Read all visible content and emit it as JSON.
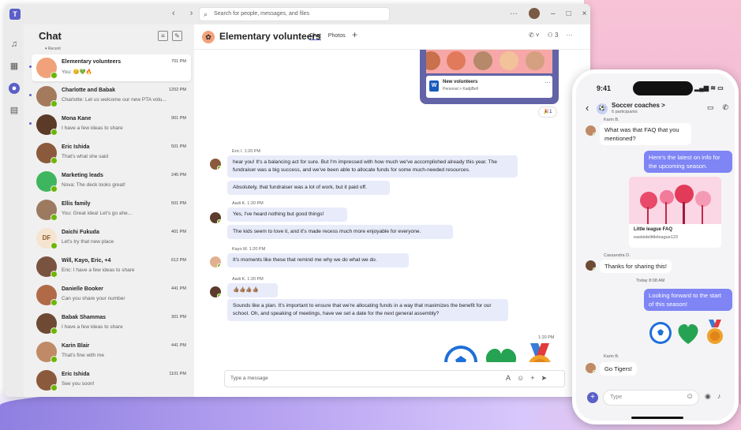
{
  "app": {
    "search_placeholder": "Search for people, messages, and files",
    "nav_arrows": "‹ ›",
    "window_controls": [
      "···",
      "–",
      "□",
      "×"
    ]
  },
  "rail": {
    "icons": [
      "bell-icon",
      "calendar-icon",
      "chat-icon",
      "files-icon"
    ]
  },
  "left": {
    "title": "Chat",
    "recent_label": "▾ Recent",
    "items": [
      {
        "name": "Elementary volunteers",
        "preview": "You: 😊💚🔥",
        "time": "701 PM",
        "avatar_color": "#f2a27a",
        "unread": true
      },
      {
        "name": "Charlotte and Babak",
        "preview": "Charlotte: Let us welcome our new PTA volu...",
        "time": "1202 PM",
        "avatar_color": "#a47a5c",
        "unread": true
      },
      {
        "name": "Mona Kane",
        "preview": "I have a few ideas to share",
        "time": "901 PM",
        "avatar_color": "#5b3a28",
        "unread": true
      },
      {
        "name": "Eric Ishida",
        "preview": "That's what she said",
        "time": "501 PM",
        "avatar_color": "#8b5a3c",
        "unread": false
      },
      {
        "name": "Marketing leads",
        "preview": "Nova: The deck looks great!",
        "time": "245 PM",
        "avatar_color": "#3fb55f",
        "unread": false
      },
      {
        "name": "Ellis family",
        "preview": "You: Great idea! Let's go ahe...",
        "time": "501 PM",
        "avatar_color": "#9c7a60",
        "unread": false
      },
      {
        "name": "Daichi Fukuda",
        "preview": "Let's try that new place",
        "time": "401 PM",
        "avatar_color": "#f5e4cf",
        "initials": "DF",
        "unread": false
      },
      {
        "name": "Will, Kayo, Eric, +4",
        "preview": "Eric: I have a few ideas to share",
        "time": "612 PM",
        "avatar_color": "#7a5240",
        "unread": false
      },
      {
        "name": "Danielle Booker",
        "preview": "Can you share your number",
        "time": "441 PM",
        "avatar_color": "#b06a48",
        "unread": false
      },
      {
        "name": "Babak Shammas",
        "preview": "I have a few ideas to share",
        "time": "301 PM",
        "avatar_color": "#6e4a35",
        "unread": false
      },
      {
        "name": "Karin Blair",
        "preview": "That's fine with me",
        "time": "441 PM",
        "avatar_color": "#c08a66",
        "unread": false
      },
      {
        "name": "Eric Ishida",
        "preview": "See you soon!",
        "time": "1101 PM",
        "avatar_color": "#8b5a3c",
        "unread": false
      }
    ]
  },
  "chat": {
    "title": "Elementary volunteers",
    "tabs": [
      "Chat",
      "Photos"
    ],
    "participants_count": "3",
    "file_card": {
      "name": "New volunteers",
      "path": "Personal > KadjiBell"
    },
    "reaction": "🎉1",
    "messages": [
      {
        "header": "Eric I.  1:20 PM",
        "bubbles": [
          "hear you! It's a balancing act for sure. But I'm impressed with how much we've accomplished already this year. The fundraiser was a big success, and we've been able to allocate funds for some much-needed resources.",
          "Absolutely, that fundraiser was a lot of work, but it paid off."
        ]
      },
      {
        "header": "Aadi K.  1:20 PM",
        "bubbles": [
          "Yes, I've heard nothing but good things!",
          "The kids seem to love it, and it's made recess much more enjoyable for everyone."
        ]
      },
      {
        "header": "Kayo M.  1:20 PM",
        "bubbles": [
          "It's moments like these that remind me why we do what we do."
        ]
      },
      {
        "header": "Aadi K.  1:20 PM",
        "bubbles": [
          "👍🏽👍🏽👍🏽👍🏽",
          "Sounds like a plan. It's important to ensure that we're allocating funds in a way that maximizes the benefit for our school. Oh, and speaking of meetings, have we set a date for the next general assembly?"
        ]
      }
    ],
    "self_time": "1:20 PM",
    "compose_placeholder": "Type a message"
  },
  "phone": {
    "time": "9:41",
    "status": "▂▄▆ ≋ ▭",
    "group_name": "Soccer coaches >",
    "group_sub": "6 participants",
    "messages": [
      {
        "meta": "Karin B.",
        "text": "What was that FAQ that you mentioned?"
      },
      {
        "text": "Here's the latest on info for the upcoming season."
      },
      {
        "link_title": "Little league FAQ",
        "link_url": "eastsidelittleleague123"
      },
      {
        "meta": "Cassandra D.",
        "text": "Thanks for sharing this!"
      },
      {
        "meta": "Today 8:08 AM"
      },
      {
        "text": "Looking forward to the start of this season!"
      },
      {
        "meta": "Karin B.",
        "text": "Go Tigers!"
      }
    ],
    "compose_placeholder": "Type"
  }
}
